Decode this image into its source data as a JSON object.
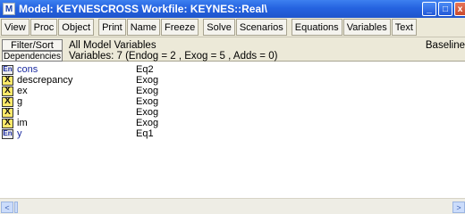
{
  "window": {
    "title": "Model: KEYNESCROSS   Workfile: KEYNES::Real\\",
    "app_icon_letter": "M",
    "minimize_glyph": "_",
    "maximize_glyph": "□",
    "close_glyph": "x"
  },
  "toolbar": {
    "buttons": [
      "View",
      "Proc",
      "Object",
      "Print",
      "Name",
      "Freeze",
      "Solve",
      "Scenarios",
      "Equations",
      "Variables",
      "Text"
    ]
  },
  "info": {
    "filter_button": "Filter/Sort",
    "dependencies_button": "Dependencies",
    "line1": "All Model Variables",
    "line2": "Variables: 7  (Endog = 2 , Exog = 5 , Adds = 0)",
    "scenario": "Baseline"
  },
  "variables": [
    {
      "icon": "En",
      "kind": "endog",
      "name": "cons",
      "desc": "Eq2"
    },
    {
      "icon": "X",
      "kind": "exog",
      "name": "descrepancy",
      "desc": "Exog"
    },
    {
      "icon": "X",
      "kind": "exog",
      "name": "ex",
      "desc": "Exog"
    },
    {
      "icon": "X",
      "kind": "exog",
      "name": "g",
      "desc": "Exog"
    },
    {
      "icon": "X",
      "kind": "exog",
      "name": "i",
      "desc": "Exog"
    },
    {
      "icon": "X",
      "kind": "exog",
      "name": "im",
      "desc": "Exog"
    },
    {
      "icon": "En",
      "kind": "endog",
      "name": "y",
      "desc": "Eq1"
    }
  ],
  "scrollbar": {
    "left_arrow": "<",
    "right_arrow": ">"
  },
  "colors": {
    "titlebar": "#2563e0",
    "endog_text": "#1a2aa0",
    "exog_icon": "#ffe96a"
  }
}
